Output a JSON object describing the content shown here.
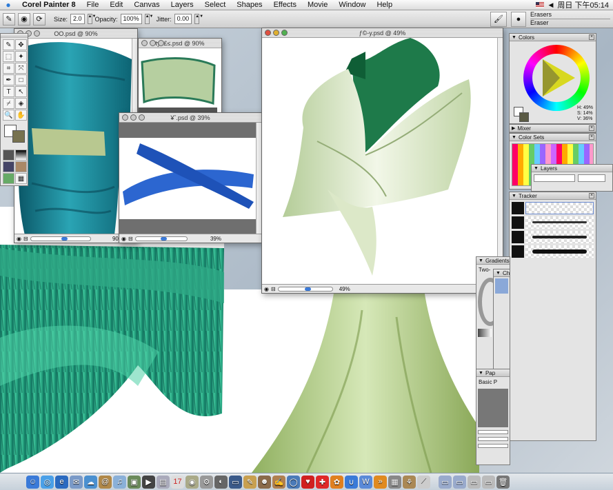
{
  "menubar": {
    "app_name": "Corel Painter 8",
    "items": [
      "File",
      "Edit",
      "Canvas",
      "Layers",
      "Select",
      "Shapes",
      "Effects",
      "Movie",
      "Window",
      "Help"
    ],
    "clock": "周日 下午05:14"
  },
  "propbar": {
    "size_label": "Size:",
    "size_value": "2.0",
    "opacity_label": "Opacity:",
    "opacity_value": "100%",
    "jitter_label": "Jitter:",
    "jitter_value": "0.00",
    "brush_category": "Erasers",
    "brush_variant": "Eraser"
  },
  "windows": {
    "skirt_doc": {
      "title": "OO.psd @ 90%",
      "zoom": "90%"
    },
    "band_doc": {
      "title": "tyh£≤.psd @ 90%"
    },
    "sash_doc": {
      "title": "¥ˆ.psd @ 39%",
      "zoom": "39%"
    },
    "top_doc": {
      "title": "ƒ©-y.psd @ 49%",
      "zoom": "49%"
    }
  },
  "panels": {
    "colors": {
      "title": "Colors",
      "h": "H: 49%",
      "s": "S: 14%",
      "v": "V: 36%"
    },
    "mixer": {
      "title": "Mixer"
    },
    "color_sets": {
      "title": "Color Sets"
    },
    "layers": {
      "title": "Layers"
    },
    "tracker": {
      "title": "Tracker"
    },
    "gradients": {
      "title": "Gradients",
      "type": "Two-"
    },
    "channels": {
      "title": "Ch"
    },
    "papers": {
      "title": "Pap",
      "paper_name": "Basic P"
    }
  },
  "colors_accent": {
    "teal": "#1d7c8c",
    "green": "#2aa878",
    "pale_green": "#c8dca8",
    "blue": "#2460c8"
  }
}
